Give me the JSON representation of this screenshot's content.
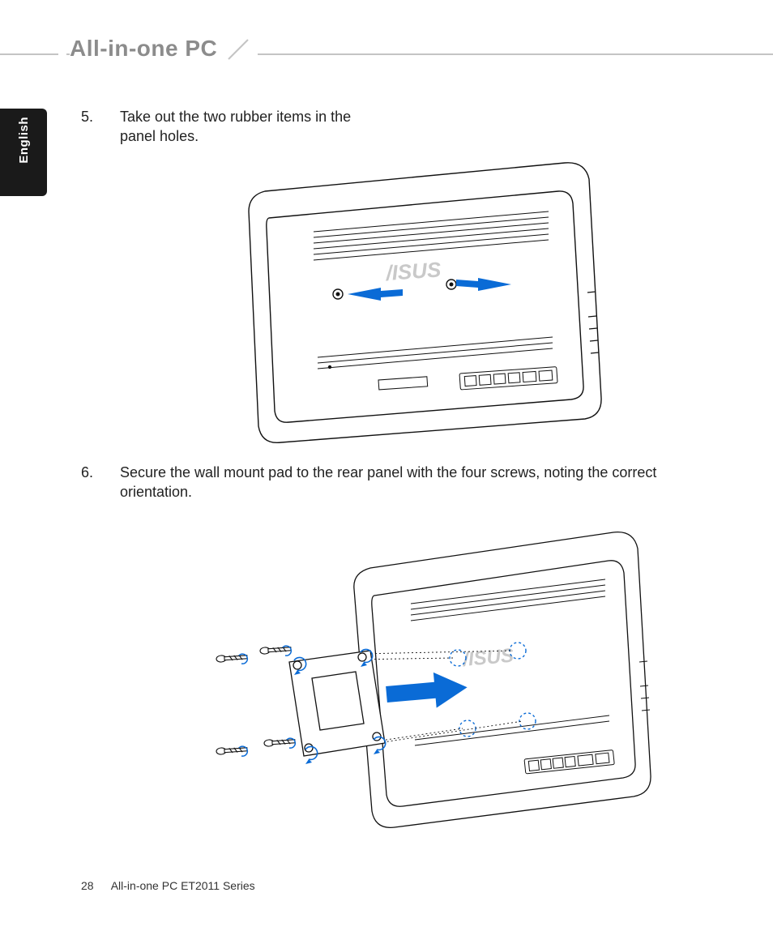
{
  "header": {
    "title": "All-in-one PC"
  },
  "side_tab": {
    "label": "English"
  },
  "steps": [
    {
      "num": "5.",
      "text": "Take out the two rubber items in the panel holes."
    },
    {
      "num": "6.",
      "text": "Secure the wall mount pad to the rear panel with the four screws, noting the correct orientation."
    }
  ],
  "footer": {
    "page_number": "28",
    "doc_title": "All-in-one PC ET2011 Series"
  },
  "illustrations": {
    "fig5_alt": "Rear of All-in-one PC showing two arrows pointing to rubber plugs in panel holes",
    "fig6_alt": "Wall mount pad being secured to rear panel with four screws and large arrow indicating direction"
  }
}
